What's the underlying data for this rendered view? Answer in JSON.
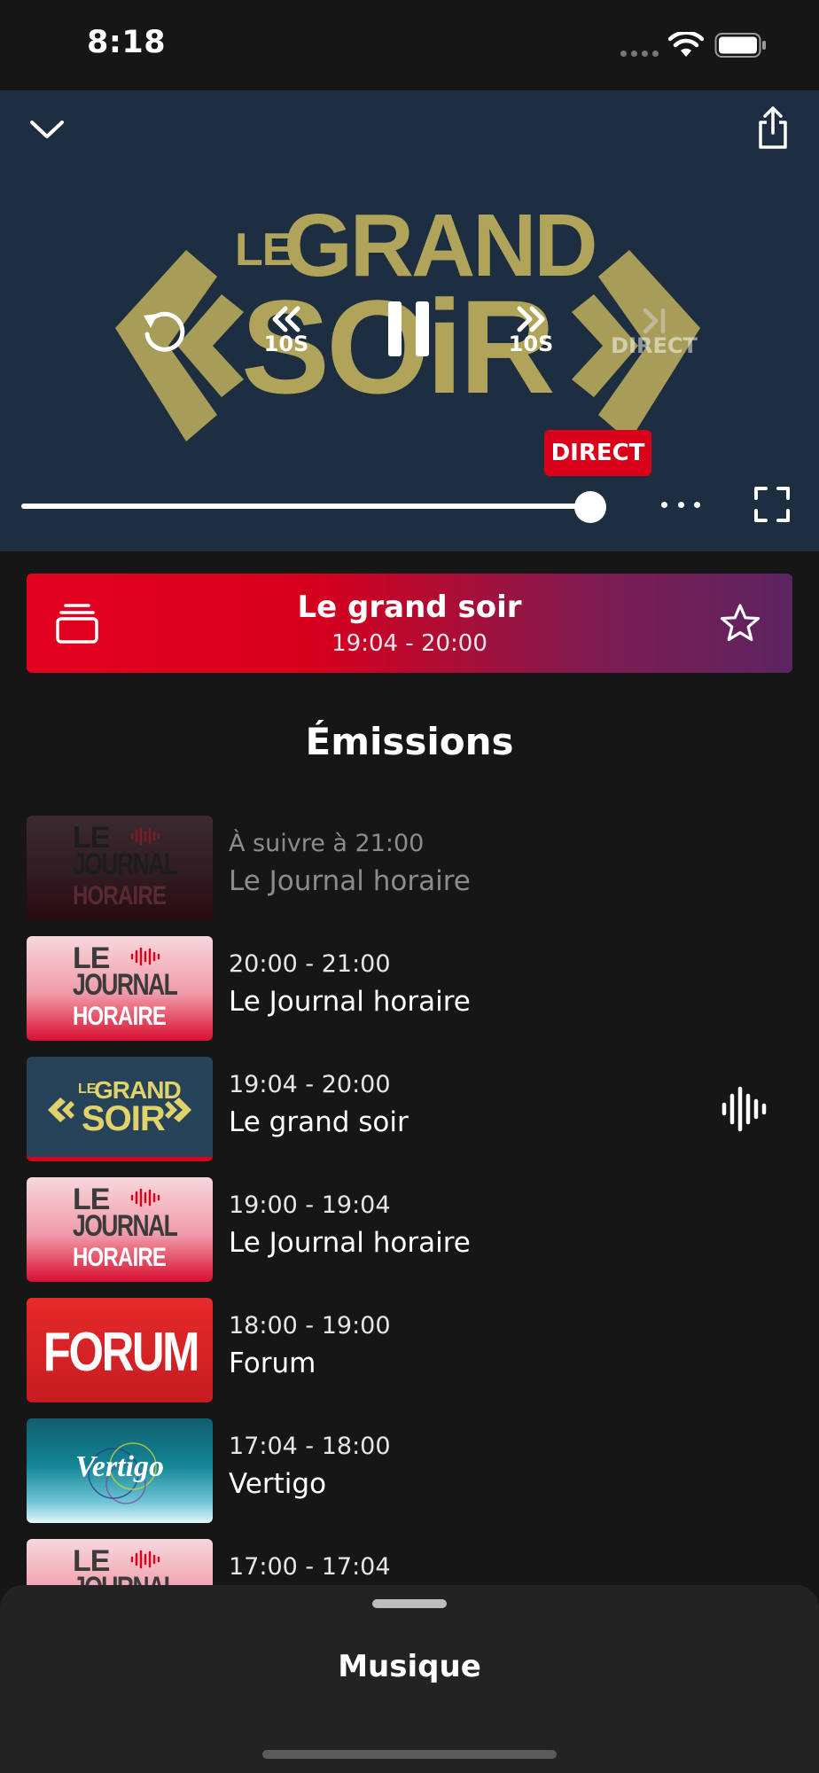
{
  "status_bar": {
    "time": "8:18"
  },
  "player": {
    "logo": {
      "le": "LE",
      "grand": "GRAND",
      "soir": "SOiR"
    },
    "controls": {
      "skip_back_label": "10S",
      "skip_forward_label": "10S",
      "direct_label": "DIRECT"
    },
    "live_badge": "DIRECT",
    "progress_fraction": 0.95
  },
  "now_playing": {
    "title": "Le grand soir",
    "time": "19:04 - 20:00"
  },
  "section_title": "Émissions",
  "thumb_logos": {
    "journal": {
      "le": "LE",
      "journal": "JOURNAL",
      "horaire": "HORAIRE"
    },
    "soir": {
      "le": "LE",
      "grand": "GRAND",
      "soir": "SOIR"
    },
    "forum": "FORUM",
    "vertigo": "Vertigo"
  },
  "programs": [
    {
      "time": "À suivre à 21:00",
      "title": "Le Journal horaire",
      "thumb": "journal",
      "state": "upcoming"
    },
    {
      "time": "20:00 - 21:00",
      "title": "Le Journal horaire",
      "thumb": "journal"
    },
    {
      "time": "19:04 - 20:00",
      "title": "Le grand soir",
      "thumb": "soir",
      "state": "live"
    },
    {
      "time": "19:00 - 19:04",
      "title": "Le Journal horaire",
      "thumb": "journal"
    },
    {
      "time": "18:00 - 19:00",
      "title": "Forum",
      "thumb": "forum"
    },
    {
      "time": "17:04 - 18:00",
      "title": "Vertigo",
      "thumb": "vertigo"
    },
    {
      "time": "17:00 - 17:04",
      "title": "",
      "thumb": "journal"
    }
  ],
  "bottom_sheet": {
    "title": "Musique"
  },
  "colors": {
    "accent_red": "#d9001a",
    "player_bg": "#1d2e40",
    "logo_gold": "#b0a35a",
    "app_bg": "#161616"
  }
}
